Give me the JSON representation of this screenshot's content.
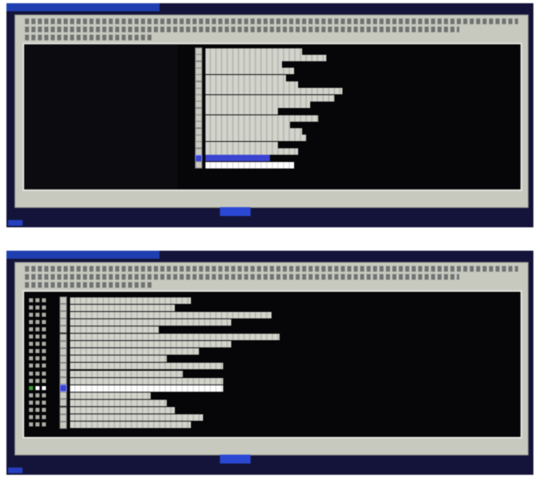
{
  "screen_top": {
    "window_title": "",
    "help_text": [
      "",
      "",
      ""
    ],
    "options": [
      {
        "selected": false,
        "highlighted": false
      },
      {
        "selected": false,
        "highlighted": false
      },
      {
        "selected": false,
        "highlighted": false
      },
      {
        "selected": false,
        "highlighted": false
      },
      {
        "selected": false,
        "highlighted": false
      },
      {
        "selected": false,
        "highlighted": false
      },
      {
        "selected": false,
        "highlighted": false
      },
      {
        "selected": false,
        "highlighted": false
      },
      {
        "selected": false,
        "highlighted": false
      },
      {
        "selected": false,
        "highlighted": false
      },
      {
        "selected": false,
        "highlighted": false
      },
      {
        "selected": false,
        "highlighted": false
      },
      {
        "selected": false,
        "highlighted": false
      },
      {
        "selected": false,
        "highlighted": false
      },
      {
        "selected": false,
        "highlighted": false
      },
      {
        "selected": false,
        "highlighted": false
      },
      {
        "selected": true,
        "highlighted": false
      },
      {
        "selected": false,
        "highlighted": true
      }
    ],
    "buttons": {
      "ok": "",
      "cancel": "",
      "help": ""
    }
  },
  "screen_bottom": {
    "window_title": "",
    "help_text": [
      "",
      "",
      ""
    ],
    "options": [
      {
        "selected": false,
        "highlighted": false
      },
      {
        "selected": false,
        "highlighted": false
      },
      {
        "selected": false,
        "highlighted": false
      },
      {
        "selected": false,
        "highlighted": false
      },
      {
        "selected": false,
        "highlighted": false
      },
      {
        "selected": false,
        "highlighted": false
      },
      {
        "selected": false,
        "highlighted": false
      },
      {
        "selected": false,
        "highlighted": false
      },
      {
        "selected": false,
        "highlighted": false
      },
      {
        "selected": false,
        "highlighted": false
      },
      {
        "selected": false,
        "highlighted": false
      },
      {
        "selected": false,
        "highlighted": false
      },
      {
        "selected": true,
        "highlighted": true
      },
      {
        "selected": false,
        "highlighted": false
      },
      {
        "selected": false,
        "highlighted": false
      },
      {
        "selected": false,
        "highlighted": false
      },
      {
        "selected": false,
        "highlighted": false
      },
      {
        "selected": false,
        "highlighted": false
      }
    ],
    "buttons": {
      "ok": "",
      "cancel": "",
      "help": ""
    }
  },
  "colors": {
    "screen_background": "#14143a",
    "dialog_panel": "#c7c9bf",
    "list_background": "#060608",
    "selection": "#3a44d0",
    "title_bar": "#1f3fb0"
  },
  "icons": {
    "checkbox": "checkbox-icon",
    "check_mark": "check-mark-icon"
  }
}
